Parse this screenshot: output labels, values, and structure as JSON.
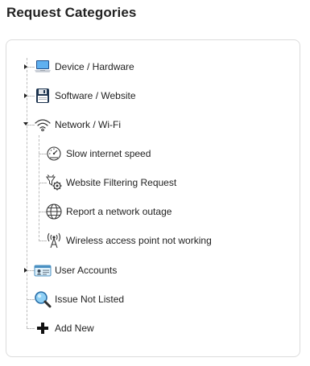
{
  "page": {
    "title": "Request Categories"
  },
  "tree": {
    "items": [
      {
        "label": "Device / Hardware",
        "icon": "laptop-icon",
        "state": "collapsed"
      },
      {
        "label": "Software / Website",
        "icon": "floppy-disk-icon",
        "state": "collapsed"
      },
      {
        "label": "Network / Wi-Fi",
        "icon": "wifi-icon",
        "state": "expanded",
        "children": [
          {
            "label": "Slow internet speed",
            "icon": "speedometer-icon"
          },
          {
            "label": "Website Filtering Request",
            "icon": "filter-gear-icon"
          },
          {
            "label": "Report a network outage",
            "icon": "globe-network-icon"
          },
          {
            "label": "Wireless access point not working",
            "icon": "antenna-icon"
          }
        ]
      },
      {
        "label": "User Accounts",
        "icon": "id-card-icon",
        "state": "collapsed"
      },
      {
        "label": "Issue Not Listed",
        "icon": "magnifier-icon",
        "state": "leaf"
      },
      {
        "label": "Add New",
        "icon": "plus-icon",
        "state": "leaf"
      }
    ]
  },
  "colors": {
    "border": "#dcdcdc",
    "tree_line": "#bdbdbd",
    "text": "#222222"
  }
}
